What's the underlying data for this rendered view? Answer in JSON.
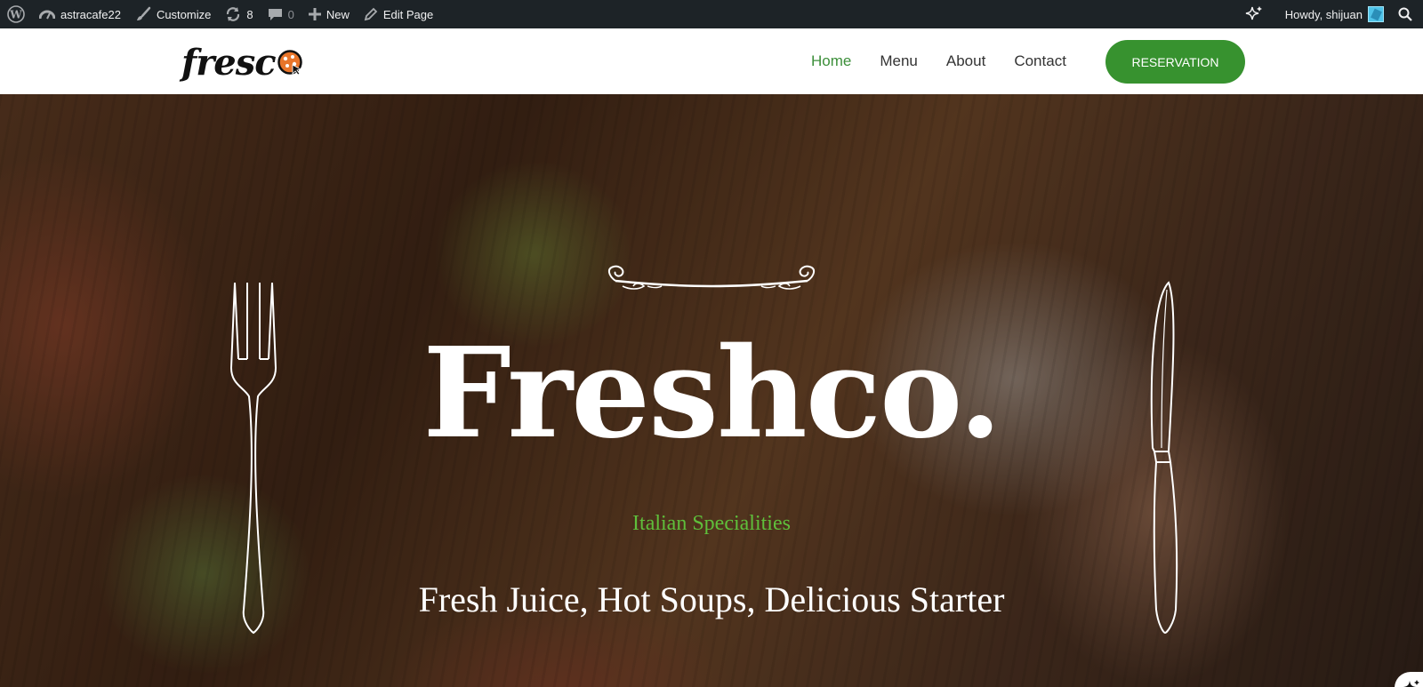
{
  "admin_bar": {
    "site_name": "astracafe22",
    "customize_label": "Customize",
    "updates_count": "8",
    "comments_count": "0",
    "new_label": "New",
    "edit_label": "Edit Page",
    "howdy_label": "Howdy, shijuan"
  },
  "header": {
    "logo_text": "fresc",
    "nav": [
      {
        "label": "Home",
        "active": true
      },
      {
        "label": "Menu",
        "active": false
      },
      {
        "label": "About",
        "active": false
      },
      {
        "label": "Contact",
        "active": false
      }
    ],
    "cta_label": "RESERVATION"
  },
  "hero": {
    "title": "Freshco.",
    "subtitle": "Italian Specialities",
    "tagline": "Fresh Juice, Hot Soups, Delicious Starter"
  },
  "colors": {
    "adminbar_bg": "#1d2327",
    "accent_green": "#37922f",
    "subtitle_green": "#5fbf3b",
    "nav_active": "#3c8f3a",
    "logo_orange": "#e8752a"
  },
  "icons": [
    "wordpress-icon",
    "dashboard-icon",
    "brush-icon",
    "updates-icon",
    "comment-icon",
    "plus-icon",
    "pencil-icon",
    "ai-sparkle-icon",
    "search-icon",
    "fork-icon",
    "knife-icon",
    "flourish-divider-icon"
  ]
}
